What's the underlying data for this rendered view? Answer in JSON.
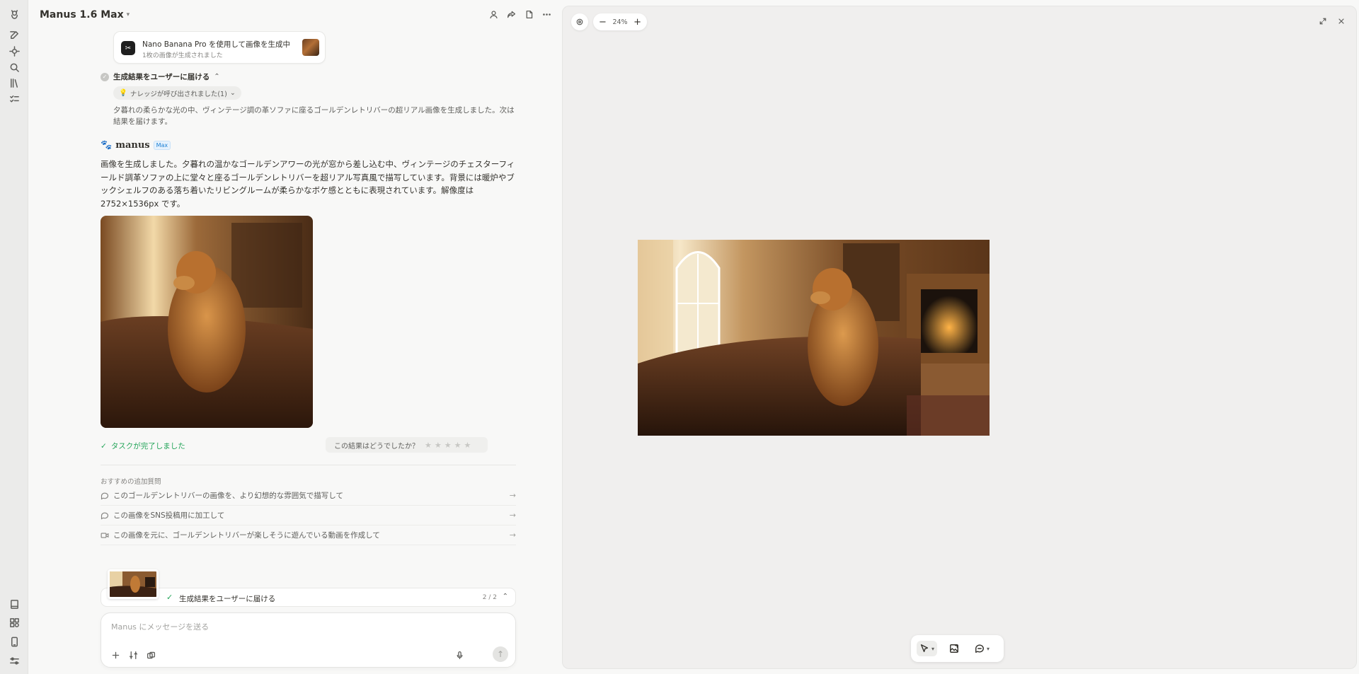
{
  "header": {
    "model": "Manus 1.6 Max",
    "icons": [
      "person-icon",
      "share-icon",
      "file-icon",
      "more-icon"
    ]
  },
  "sidebar": {
    "top_icons": [
      "manus-logo-icon",
      "new-task-icon",
      "agents-icon",
      "search-icon",
      "library-icon",
      "tasks-icon"
    ],
    "bottom_icons": [
      "book-icon",
      "apps-icon",
      "mobile-icon",
      "settings-icon"
    ]
  },
  "tool_card": {
    "title": "Nano Banana Pro を使用して画像を生成中",
    "subtitle": "1枚の画像が生成されました"
  },
  "step": {
    "label": "生成結果をユーザーに届ける",
    "knowledge": "ナレッジが呼び出されました(1)",
    "description": "夕暮れの柔らかな光の中、ヴィンテージ調の革ソファに座るゴールデンレトリバーの超リアル画像を生成しました。次は結果を届けます。"
  },
  "agent": {
    "name": "manus",
    "badge": "Max",
    "message": "画像を生成しました。夕暮れの温かなゴールデンアワーの光が窓から差し込む中、ヴィンテージのチェスターフィールド調革ソファの上に堂々と座るゴールデンレトリバーを超リアル写真風で描写しています。背景には暖炉やブックシェルフのある落ち着いたリビングルームが柔らかなボケ感とともに表現されています。解像度は 2752×1536px です。"
  },
  "status": {
    "done": "タスクが完了しました",
    "rating_prompt": "この結果はどうでしたか？",
    "stars": 5
  },
  "suggestions": {
    "heading": "おすすめの追加質問",
    "items": [
      "このゴールデンレトリバーの画像を、より幻想的な雰囲気で描写して",
      "この画像をSNS投稿用に加工して",
      "この画像を元に、ゴールデンレトリバーが楽しそうに遊んでいる動画を作成して"
    ]
  },
  "progress": {
    "label": "生成結果をユーザーに届ける",
    "count": "2 / 2"
  },
  "composer": {
    "placeholder": "Manus にメッセージを送る"
  },
  "viewer": {
    "zoom": "24%",
    "tools": [
      "select-tool",
      "edit-image-tool",
      "comment-tool"
    ]
  }
}
